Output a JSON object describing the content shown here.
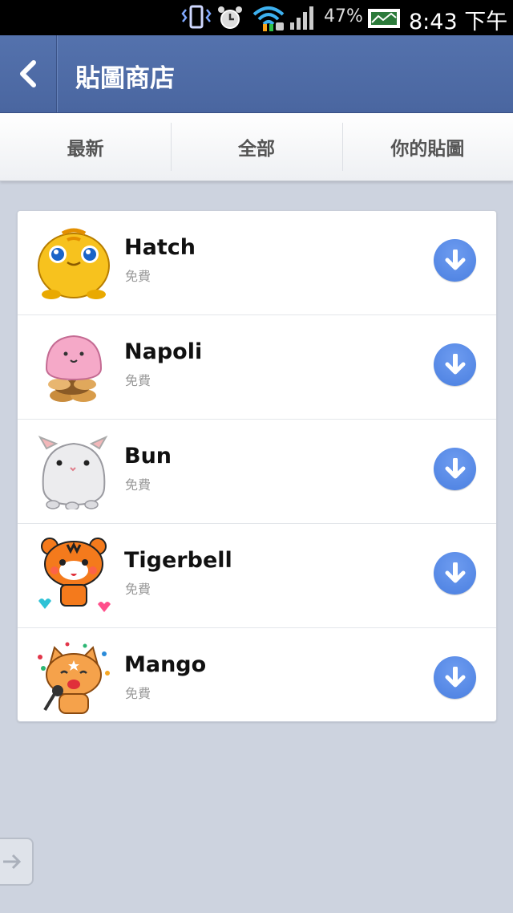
{
  "status_bar": {
    "battery_percent": "47%",
    "time": "8:43 下午",
    "icons": [
      "vibrate-icon",
      "alarm-icon",
      "wifi-icon",
      "signal-icon",
      "battery-icon"
    ]
  },
  "header": {
    "title": "貼圖商店",
    "back_icon": "chevron-left-icon"
  },
  "tabs": [
    {
      "label": "最新"
    },
    {
      "label": "全部"
    },
    {
      "label": "你的貼圖"
    }
  ],
  "stickers": [
    {
      "name": "Hatch",
      "price": "免費"
    },
    {
      "name": "Napoli",
      "price": "免費"
    },
    {
      "name": "Bun",
      "price": "免費"
    },
    {
      "name": "Tigerbell",
      "price": "免費"
    },
    {
      "name": "Mango",
      "price": "免費"
    }
  ],
  "colors": {
    "header": "#4f6ca6",
    "background": "#cdd3df",
    "download_button": "#5a8be6"
  }
}
